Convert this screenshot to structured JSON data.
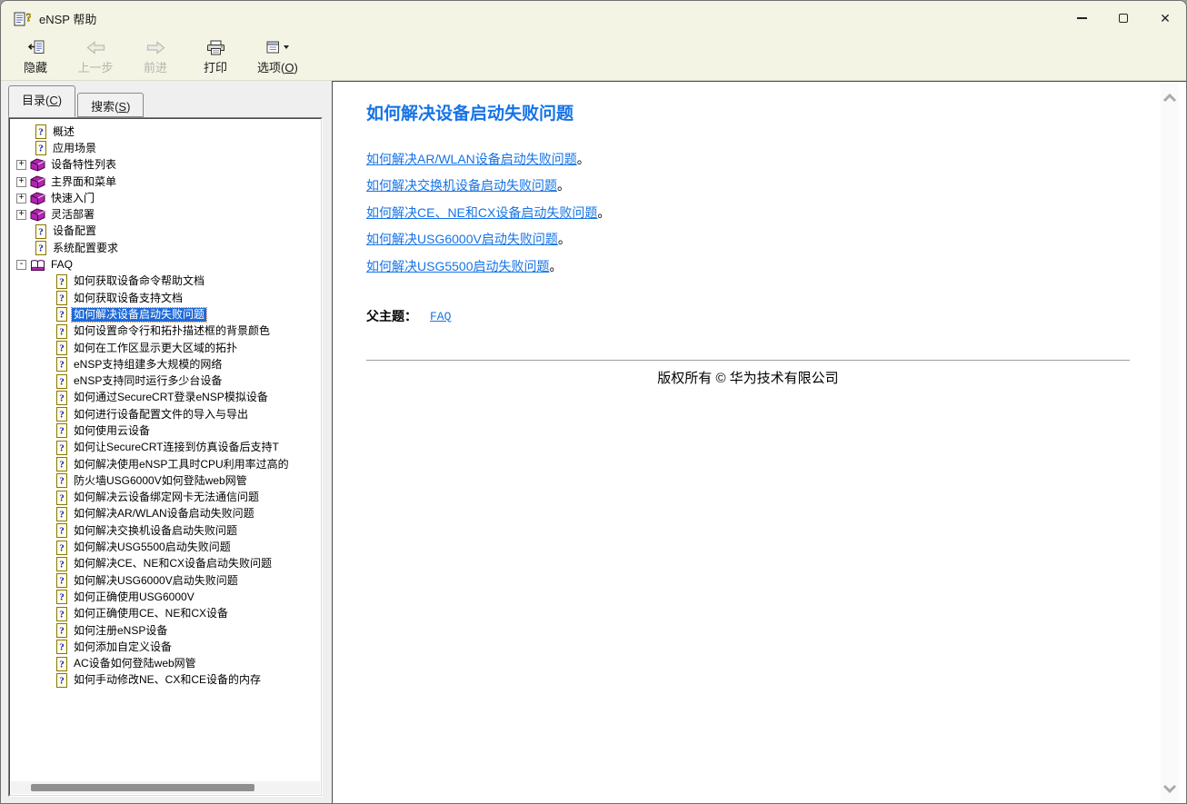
{
  "window": {
    "title": "eNSP 帮助",
    "controls": [
      {
        "name": "minimize",
        "glyph": "–"
      },
      {
        "name": "maximize",
        "glyph": "▢"
      },
      {
        "name": "close",
        "glyph": "✕"
      }
    ]
  },
  "toolbar": {
    "buttons": [
      {
        "id": "hide",
        "label": "隐藏",
        "icon": "hide-panel-icon",
        "enabled": true
      },
      {
        "id": "back",
        "label": "上一步",
        "icon": "back-arrow-icon",
        "enabled": false
      },
      {
        "id": "forward",
        "label": "前进",
        "icon": "forward-arrow-icon",
        "enabled": false
      },
      {
        "id": "print",
        "label": "打印",
        "icon": "printer-icon",
        "enabled": true
      },
      {
        "id": "options",
        "label_pre": "选项(",
        "label_key": "O",
        "label_post": ")",
        "icon": "options-icon",
        "enabled": true,
        "has_dropdown": true
      }
    ]
  },
  "tabs": [
    {
      "id": "contents",
      "label_pre": "目录(",
      "label_key": "C",
      "label_post": ")",
      "active": true
    },
    {
      "id": "search",
      "label_pre": "搜索(",
      "label_key": "S",
      "label_post": ")",
      "active": false
    }
  ],
  "tree": {
    "items": [
      {
        "type": "topic",
        "level": 0,
        "label": "概述"
      },
      {
        "type": "topic",
        "level": 0,
        "label": "应用场景"
      },
      {
        "type": "book-closed",
        "level": 0,
        "label": "设备特性列表",
        "expander": "+"
      },
      {
        "type": "book-closed",
        "level": 0,
        "label": "主界面和菜单",
        "expander": "+"
      },
      {
        "type": "book-closed",
        "level": 0,
        "label": "快速入门",
        "expander": "+"
      },
      {
        "type": "book-closed",
        "level": 0,
        "label": "灵活部署",
        "expander": "+"
      },
      {
        "type": "topic",
        "level": 0,
        "label": "设备配置"
      },
      {
        "type": "topic",
        "level": 0,
        "label": "系统配置要求"
      },
      {
        "type": "book-open",
        "level": 0,
        "label": "FAQ",
        "expander": "-"
      },
      {
        "type": "topic",
        "level": 1,
        "label": "如何获取设备命令帮助文档"
      },
      {
        "type": "topic",
        "level": 1,
        "label": "如何获取设备支持文档"
      },
      {
        "type": "topic",
        "level": 1,
        "label": "如何解决设备启动失败问题",
        "selected": true
      },
      {
        "type": "topic",
        "level": 1,
        "label": "如何设置命令行和拓扑描述框的背景颜色"
      },
      {
        "type": "topic",
        "level": 1,
        "label": "如何在工作区显示更大区域的拓扑"
      },
      {
        "type": "topic",
        "level": 1,
        "label": "eNSP支持组建多大规模的网络"
      },
      {
        "type": "topic",
        "level": 1,
        "label": "eNSP支持同时运行多少台设备"
      },
      {
        "type": "topic",
        "level": 1,
        "label": "如何通过SecureCRT登录eNSP模拟设备"
      },
      {
        "type": "topic",
        "level": 1,
        "label": "如何进行设备配置文件的导入与导出"
      },
      {
        "type": "topic",
        "level": 1,
        "label": "如何使用云设备"
      },
      {
        "type": "topic",
        "level": 1,
        "label": "如何让SecureCRT连接到仿真设备后支持T"
      },
      {
        "type": "topic",
        "level": 1,
        "label": "如何解决使用eNSP工具时CPU利用率过高的"
      },
      {
        "type": "topic",
        "level": 1,
        "label": "防火墙USG6000V如何登陆web网管"
      },
      {
        "type": "topic",
        "level": 1,
        "label": "如何解决云设备绑定网卡无法通信问题"
      },
      {
        "type": "topic",
        "level": 1,
        "label": "如何解决AR/WLAN设备启动失败问题"
      },
      {
        "type": "topic",
        "level": 1,
        "label": "如何解决交换机设备启动失败问题"
      },
      {
        "type": "topic",
        "level": 1,
        "label": "如何解决USG5500启动失败问题"
      },
      {
        "type": "topic",
        "level": 1,
        "label": "如何解决CE、NE和CX设备启动失败问题"
      },
      {
        "type": "topic",
        "level": 1,
        "label": "如何解决USG6000V启动失败问题"
      },
      {
        "type": "topic",
        "level": 1,
        "label": "如何正确使用USG6000V"
      },
      {
        "type": "topic",
        "level": 1,
        "label": "如何正确使用CE、NE和CX设备"
      },
      {
        "type": "topic",
        "level": 1,
        "label": "如何注册eNSP设备"
      },
      {
        "type": "topic",
        "level": 1,
        "label": "如何添加自定义设备"
      },
      {
        "type": "topic",
        "level": 1,
        "label": "AC设备如何登陆web网管"
      },
      {
        "type": "topic",
        "level": 1,
        "label": "如何手动修改NE、CX和CE设备的内存"
      }
    ]
  },
  "content": {
    "heading": "如何解决设备启动失败问题",
    "links": [
      {
        "text": "如何解决AR/WLAN设备启动失败问题",
        "suffix": "。"
      },
      {
        "text": "如何解决交换机设备启动失败问题",
        "suffix": "。"
      },
      {
        "text": "如何解决CE、NE和CX设备启动失败问题",
        "suffix": "。"
      },
      {
        "text": "如何解决USG6000V启动失败问题",
        "suffix": "。"
      },
      {
        "text": "如何解决USG5500启动失败问题",
        "suffix": " 。"
      }
    ],
    "parent_topic_label": "父主题：",
    "parent_topic_link": "FAQ",
    "copyright": "版权所有 © 华为技术有限公司"
  },
  "icons": {
    "app": "help-document-with-question-mark",
    "scroll_up": "chevron-up",
    "scroll_down": "chevron-down",
    "expander_collapsed": "+",
    "expander_expanded": "-"
  },
  "colors": {
    "accent_link_blue": "#1673E6",
    "selection_blue": "#1E6AD8",
    "titlebar_bg": "#F4F4E5",
    "pane_bg": "#EFEFEF"
  }
}
